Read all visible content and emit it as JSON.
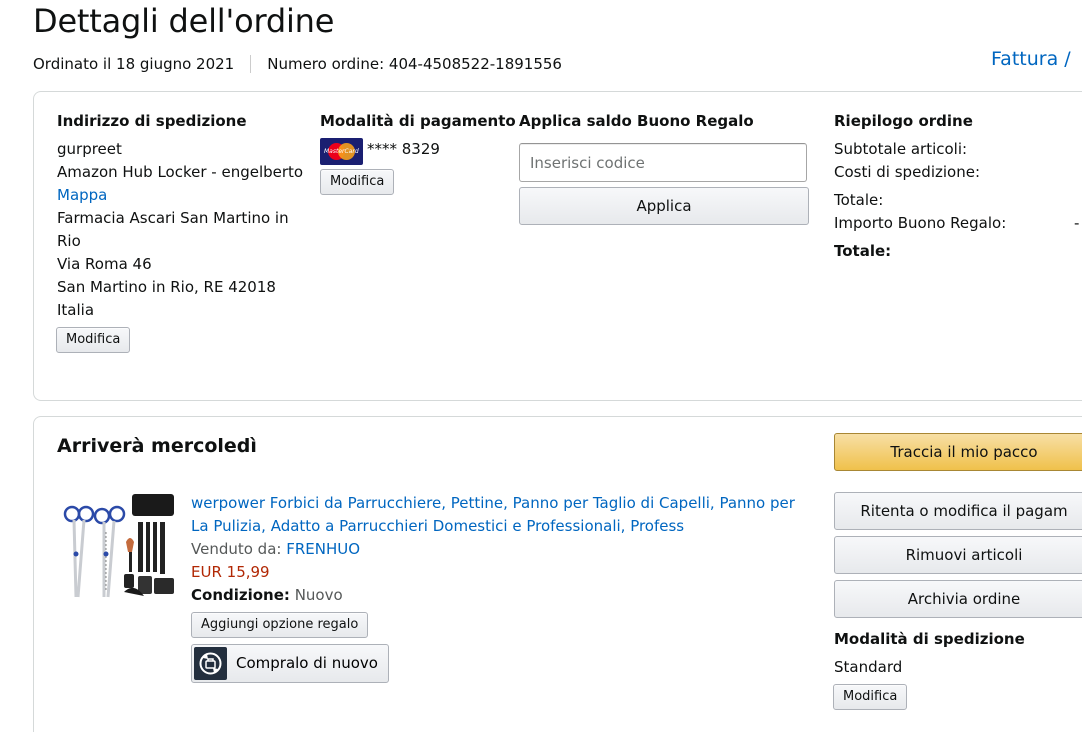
{
  "header": {
    "title": "Dettagli dell'ordine",
    "ordered_on": "Ordinato il 18 giugno 2021",
    "order_number": "Numero ordine: 404-4508522-1891556",
    "invoice_link": "Fattura /"
  },
  "shipping": {
    "heading": "Indirizzo di spedizione",
    "name": "gurpreet",
    "locker": "Amazon Hub Locker - engelberto",
    "map_link": "Mappa",
    "line1": "Farmacia Ascari San Martino in",
    "line2": "Rio",
    "street": "Via Roma 46",
    "city": "San Martino in Rio, RE 42018",
    "country": "Italia",
    "edit_label": "Modifica"
  },
  "payment": {
    "heading": "Modalità di pagamento",
    "card_brand_icon": "mastercard-icon",
    "card_brand_text": "MasterCard",
    "card_number": "**** 8329",
    "edit_label": "Modifica"
  },
  "gift_card": {
    "heading": "Applica saldo Buono Regalo",
    "placeholder": "Inserisci codice",
    "apply_label": "Applica"
  },
  "summary": {
    "heading": "Riepilogo ordine",
    "subtotal_label": "Subtotale articoli:",
    "shipping_label": "Costi di spedizione:",
    "total_label": "Totale:",
    "gift_amount_label": "Importo Buono Regalo:",
    "gift_amount_value": "-",
    "grand_total_label": "Totale:"
  },
  "shipment": {
    "arrival": "Arriverà mercoledì",
    "product_image_icon": "scissors-kit-image",
    "product_title": "werpower Forbici da Parrucchiere, Pettine, Panno per Taglio di Capelli, Panno per La Pulizia, Adatto a Parrucchieri Domestici e Professionali, Profess",
    "sold_by_label": "Venduto da:",
    "seller": "FRENHUO",
    "price": "EUR 15,99",
    "condition_label": "Condizione:",
    "condition_value": "Nuovo",
    "gift_option_label": "Aggiungi opzione regalo",
    "buy_again_icon": "buy-again-icon",
    "buy_again_label": "Compralo di nuovo"
  },
  "actions": {
    "track": "Traccia il mio pacco",
    "retry_payment": "Ritenta o modifica il pagam",
    "remove_items": "Rimuovi articoli",
    "archive": "Archivia ordine",
    "shipping_method_heading": "Modalità di spedizione",
    "shipping_method_value": "Standard",
    "edit_label": "Modifica"
  },
  "colors": {
    "link": "#0066c0",
    "price": "#b12704",
    "primary_button": "#f0c14b"
  }
}
